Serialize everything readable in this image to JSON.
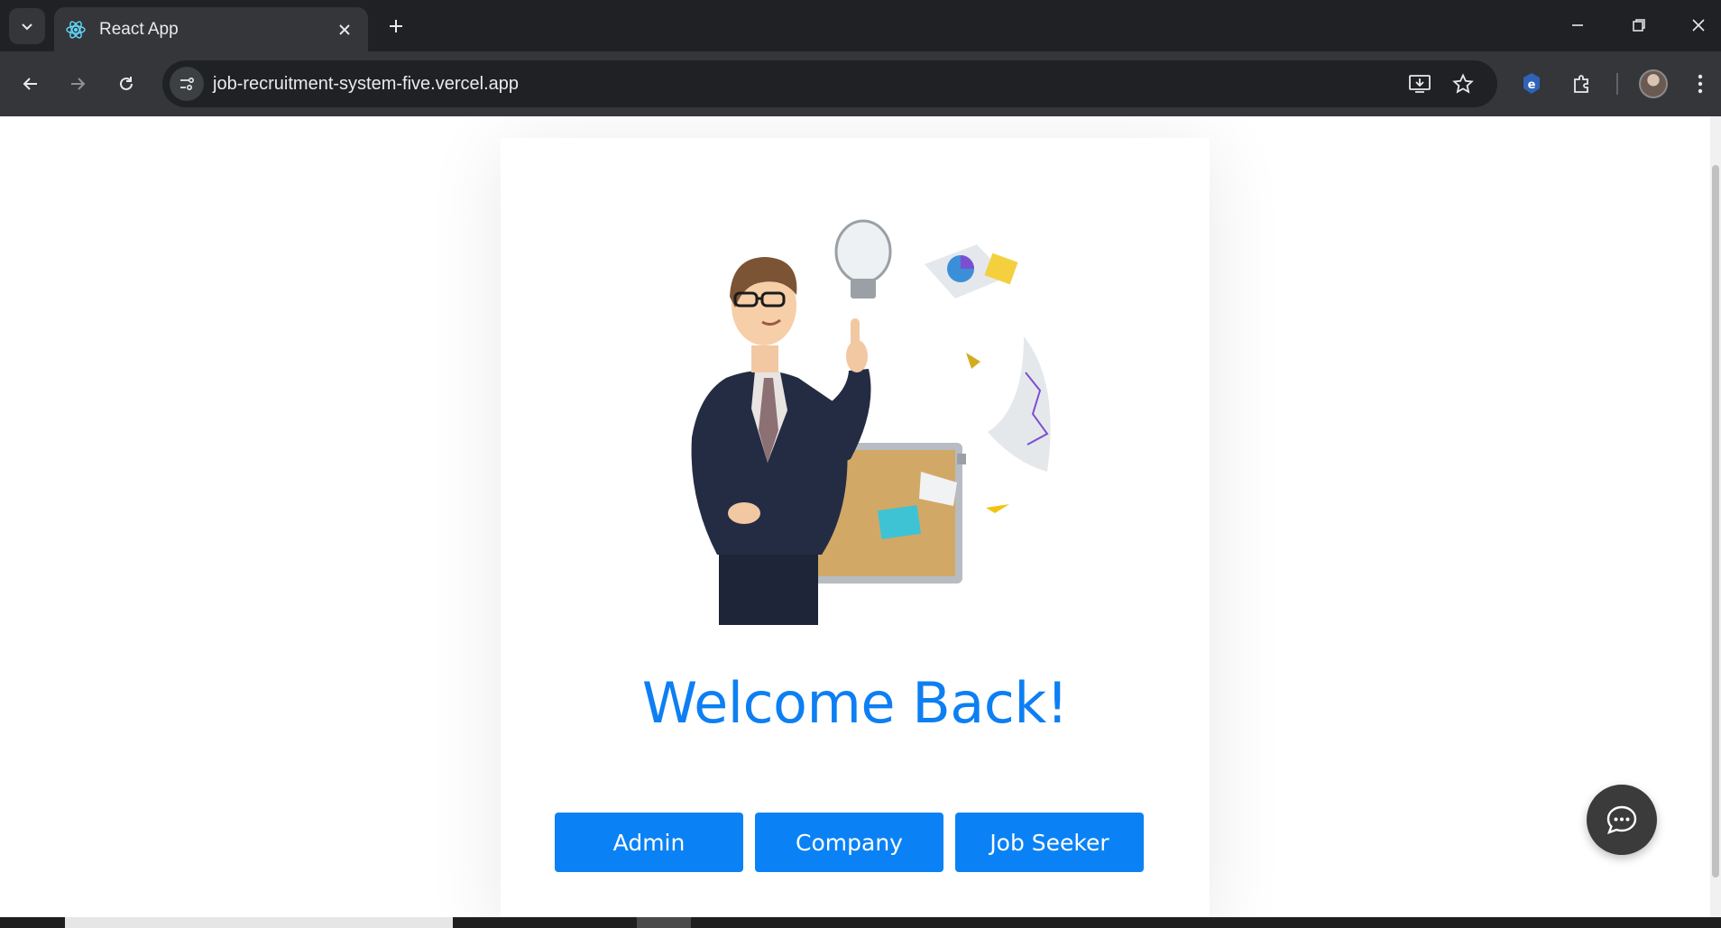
{
  "browser": {
    "tab_title": "React App",
    "url": "job-recruitment-system-five.vercel.app"
  },
  "page": {
    "heading": "Welcome Back!",
    "buttons": {
      "admin": "Admin",
      "company": "Company",
      "job_seeker": "Job Seeker"
    }
  },
  "colors": {
    "accent": "#0a82f5",
    "heading": "#0d7ff3",
    "chrome_dark": "#202124",
    "chrome_toolbar": "#35363a"
  },
  "icons": [
    "tab-search-icon",
    "react-icon",
    "close-icon",
    "plus-icon",
    "minimize-icon",
    "restore-icon",
    "window-close-icon",
    "back-icon",
    "forward-icon",
    "reload-icon",
    "site-info-icon",
    "install-app-icon",
    "star-icon",
    "extension-e-icon",
    "puzzle-icon",
    "menu-icon",
    "chat-icon"
  ]
}
